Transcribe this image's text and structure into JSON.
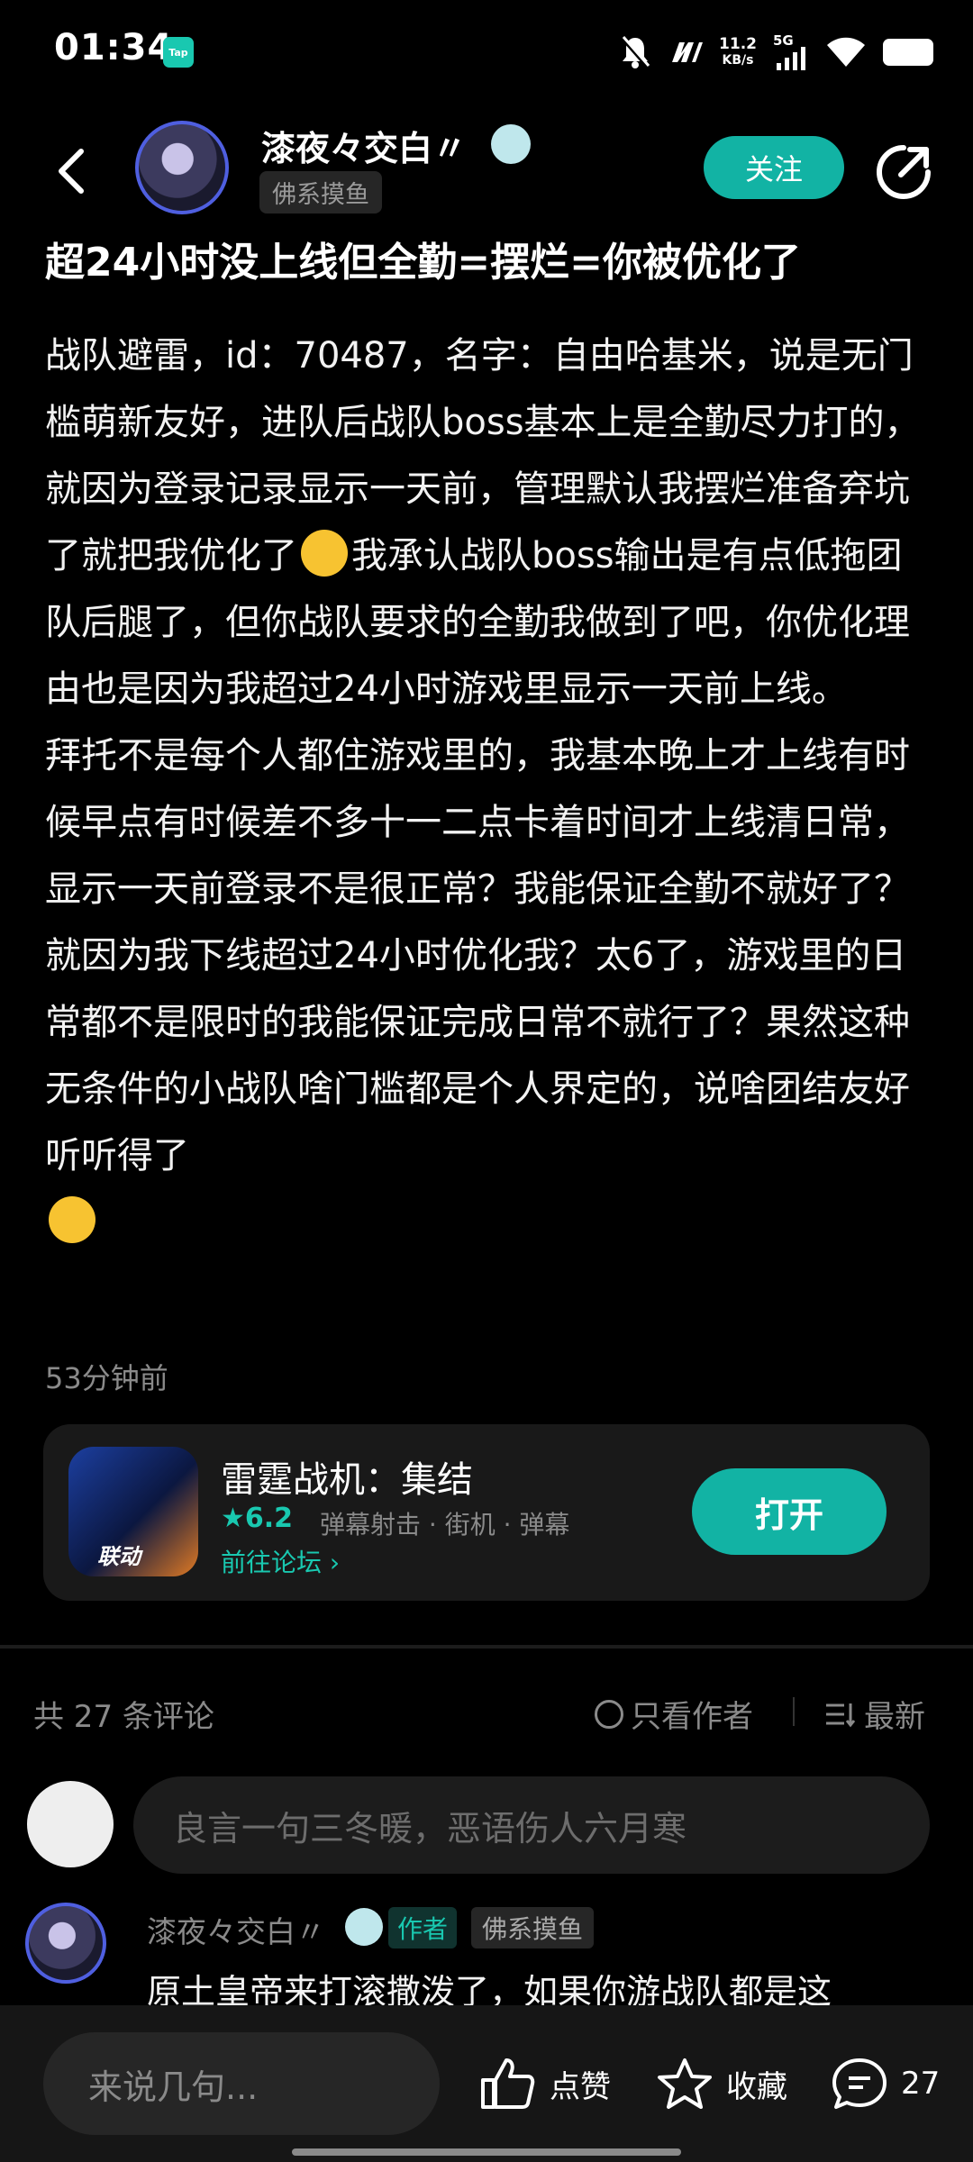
{
  "status_bar": {
    "time": "01:34",
    "app_badge": "Tap",
    "net_speed_value": "11.2",
    "net_speed_unit": "KB/s",
    "signal_label": "5G"
  },
  "header": {
    "author_name": "漆夜々交白〃",
    "author_tag": "佛系摸鱼",
    "follow_label": "关注"
  },
  "post": {
    "title": "超24小时没上线但全勤=摆烂=你被优化了",
    "paragraph1_a": "战队避雷，id：70487，名字：自由哈基米，说是无门槛萌新友好，进队后战队boss基本上是全勤尽力打的，就因为登录记录显示一天前，管理默认我摆烂准备弃坑了就把我优化了",
    "paragraph1_b": "我承认战队boss输出是有点低拖团队后腿了，但你战队要求的全勤我做到了吧，你优化理由也是因为我超过24小时游戏里显示一天前上线。",
    "paragraph2": "拜托不是每个人都住游戏里的，我基本晚上才上线有时候早点有时候差不多十一二点卡着时间才上线清日常，显示一天前登录不是很正常？我能保证全勤不就好了？就因为我下线超过24小时优化我？太6了，游戏里的日常都不是限时的我能保证完成日常不就行了？果然这种无条件的小战队啥门槛都是个人界定的，说啥团结友好听听得了",
    "time_ago": "53分钟前"
  },
  "game_card": {
    "icon_text": "联动",
    "name": "雷霆战机：集结",
    "rating": "6.2",
    "genres": "弹幕射击 · 街机 · 弹幕",
    "forum_link": "前往论坛",
    "open_label": "打开"
  },
  "comments": {
    "count_label": "共 27 条评论",
    "author_only_label": "只看作者",
    "sort_label": "最新",
    "input_placeholder": "良言一句三冬暖，恶语伤人六月寒",
    "first": {
      "name": "漆夜々交白〃",
      "author_tag": "作者",
      "user_tag": "佛系摸鱼",
      "text": "原土皇帝来打滚撒泼了，如果你游战队都是这"
    }
  },
  "bottom_bar": {
    "input_placeholder": "来说几句...",
    "like_label": "点赞",
    "favorite_label": "收藏",
    "comment_count": "27"
  },
  "colors": {
    "accent": "#12b3a4",
    "background": "#000000",
    "muted_text": "#8a8a8a"
  }
}
